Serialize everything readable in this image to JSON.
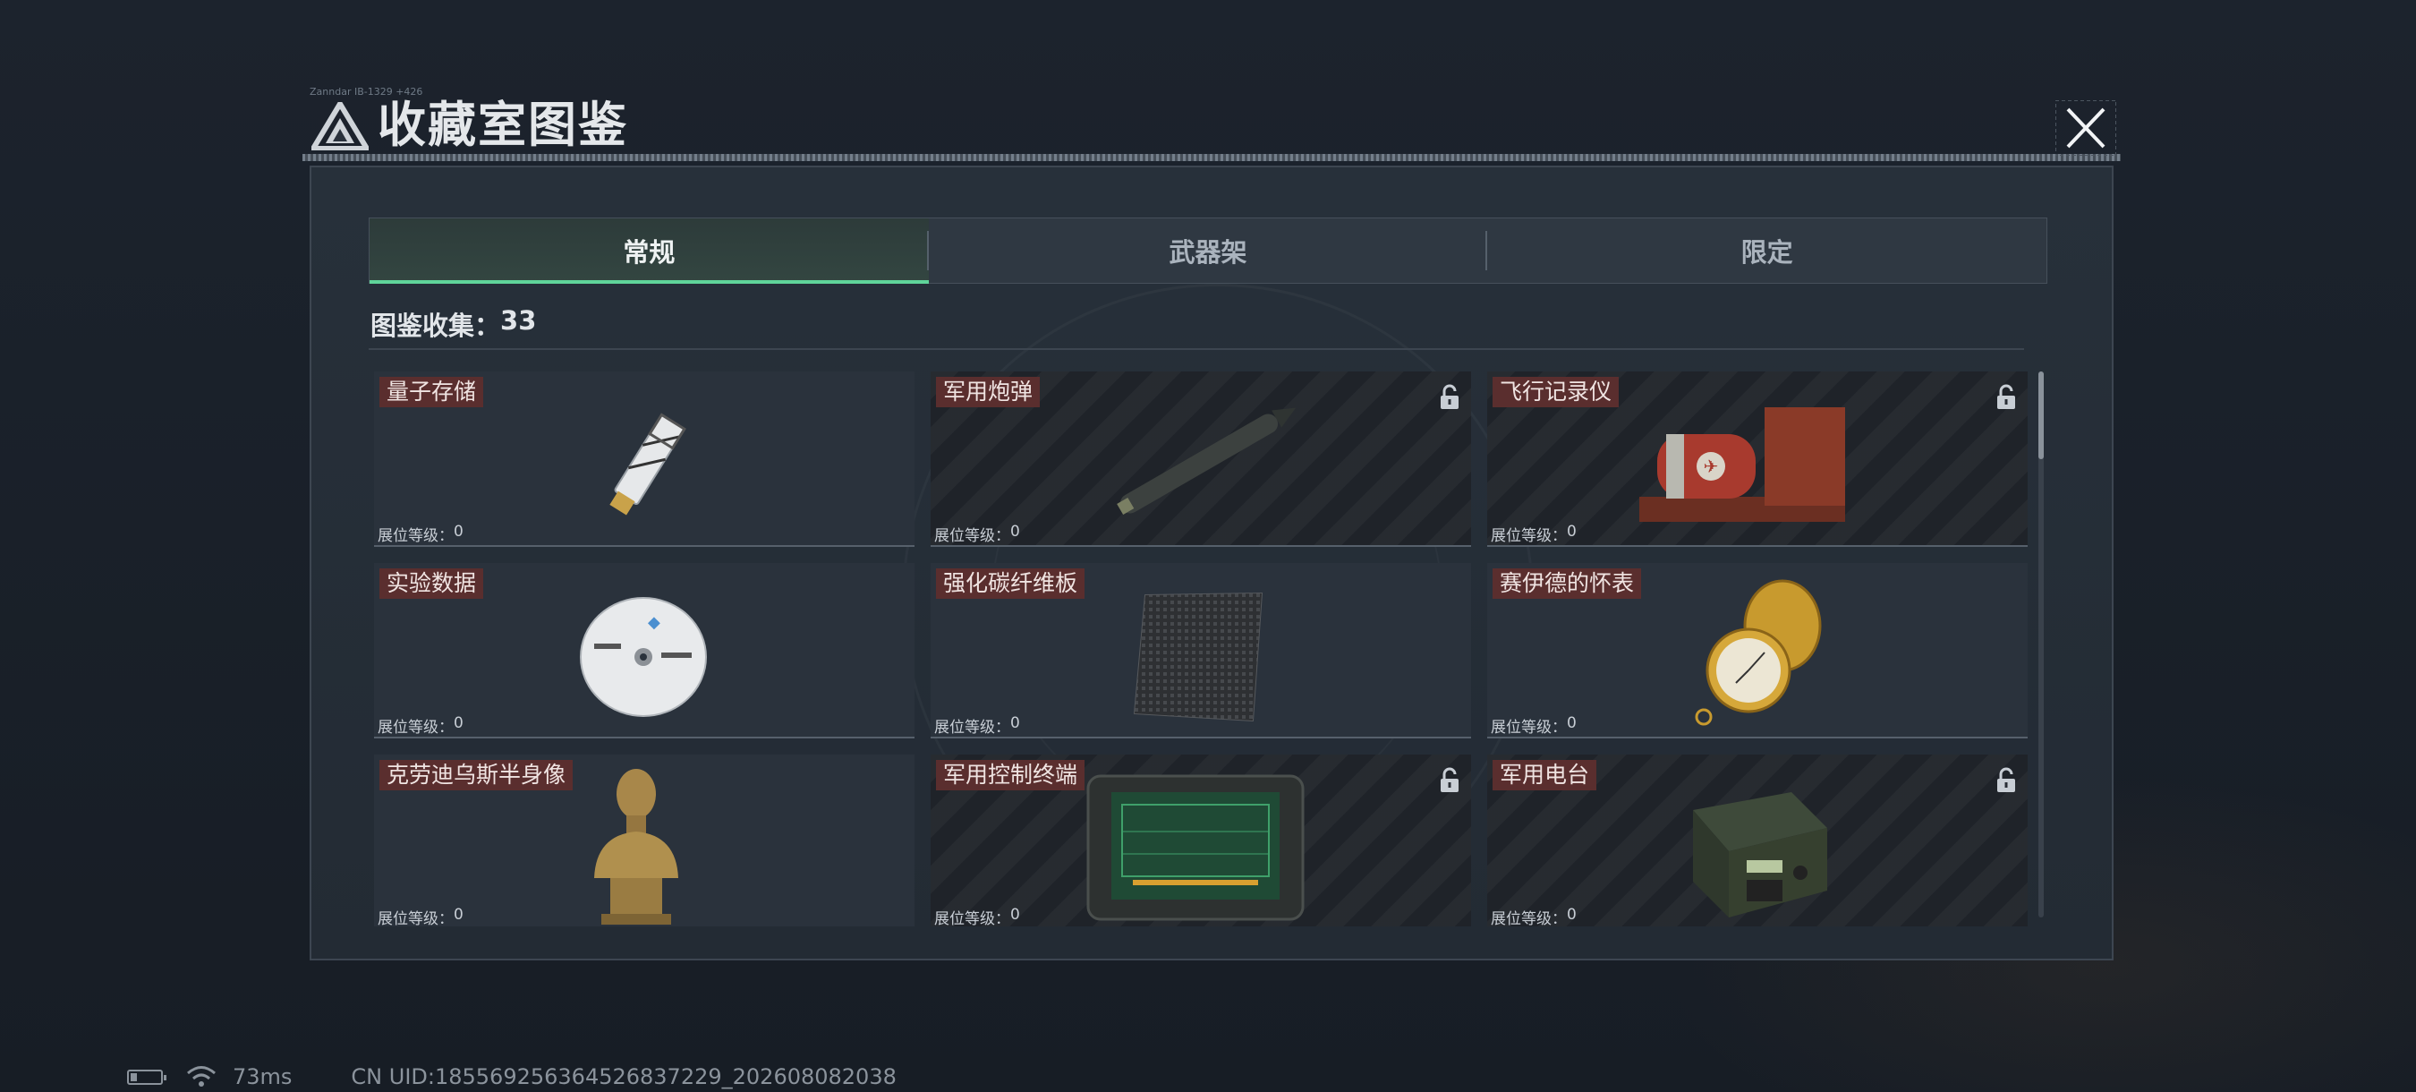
{
  "header": {
    "title": "收藏室图鉴",
    "small_code": "Zanndar IB-1329 +426"
  },
  "tabs": [
    {
      "label": "常规",
      "active": true
    },
    {
      "label": "武器架",
      "active": false
    },
    {
      "label": "限定",
      "active": false
    }
  ],
  "collection": {
    "label": "图鉴收集：",
    "count": "33"
  },
  "items": [
    {
      "name": "量子存储",
      "level_label": "展位等级：",
      "level": "0",
      "locked": false,
      "icon": "usb-drive-icon"
    },
    {
      "name": "军用炮弹",
      "level_label": "展位等级：",
      "level": "0",
      "locked": true,
      "icon": "artillery-shell-icon"
    },
    {
      "name": "飞行记录仪",
      "level_label": "展位等级：",
      "level": "0",
      "locked": true,
      "icon": "flight-recorder-icon"
    },
    {
      "name": "实验数据",
      "level_label": "展位等级：",
      "level": "0",
      "locked": false,
      "icon": "disc-icon"
    },
    {
      "name": "强化碳纤维板",
      "level_label": "展位等级：",
      "level": "0",
      "locked": false,
      "icon": "carbon-plate-icon"
    },
    {
      "name": "赛伊德的怀表",
      "level_label": "展位等级：",
      "level": "0",
      "locked": false,
      "icon": "pocket-watch-icon"
    },
    {
      "name": "克劳迪乌斯半身像",
      "level_label": "展位等级：",
      "level": "0",
      "locked": false,
      "icon": "bust-icon"
    },
    {
      "name": "军用控制终端",
      "level_label": "展位等级：",
      "level": "0",
      "locked": true,
      "icon": "control-terminal-icon"
    },
    {
      "name": "军用电台",
      "level_label": "展位等级：",
      "level": "0",
      "locked": true,
      "icon": "radio-icon"
    }
  ],
  "status_bar": {
    "ping": "73ms",
    "uid": "CN UID:185569256364526837229_202608082038"
  },
  "colors": {
    "accent": "#5fd49a",
    "label_bg": "#5a2e2e",
    "panel": "#27303a"
  }
}
